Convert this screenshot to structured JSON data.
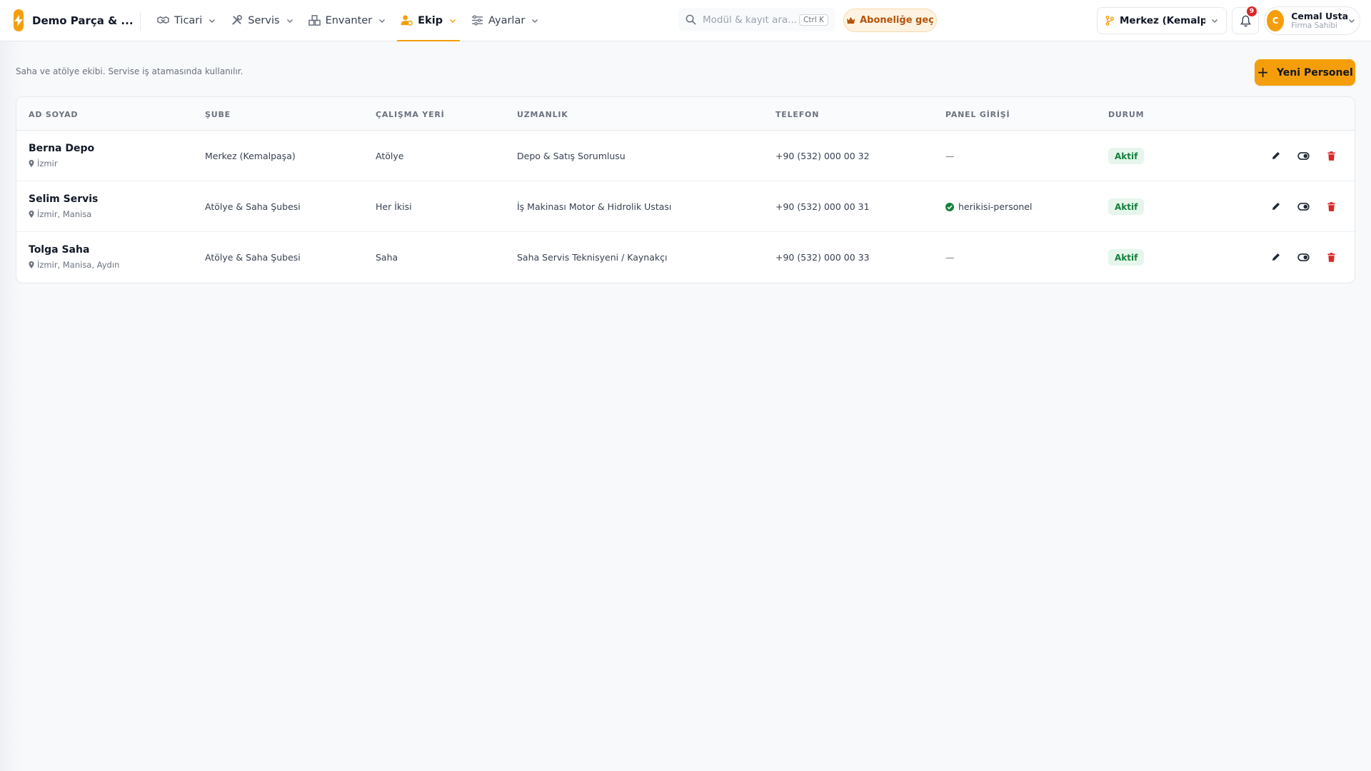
{
  "brand": {
    "name": "Demo Parça & ..."
  },
  "nav": [
    {
      "label": "Ticari",
      "icon": "handshake-icon"
    },
    {
      "label": "Servis",
      "icon": "tools-icon"
    },
    {
      "label": "Envanter",
      "icon": "boxes-icon"
    },
    {
      "label": "Ekip",
      "icon": "user-gear-icon",
      "active": true
    },
    {
      "label": "Ayarlar",
      "icon": "sliders-icon"
    }
  ],
  "search": {
    "placeholder": "Modül & kayıt ara...",
    "shortcut": "Ctrl K"
  },
  "upgrade": {
    "label": "Aboneliğe geç"
  },
  "branch": {
    "label": "Merkez (Kemalpa..."
  },
  "notifications": {
    "count": "9"
  },
  "user": {
    "initial": "C",
    "name": "Cemal Usta",
    "role": "Firma Sahibi"
  },
  "page": {
    "subtitle": "Saha ve atölye ekibi. Servise iş atamasında kullanılır.",
    "new_button": "Yeni Personel"
  },
  "table": {
    "headers": {
      "name": "AD SOYAD",
      "branch": "ŞUBE",
      "workplace": "ÇALIŞMA YERİ",
      "specialty": "UZMANLIK",
      "phone": "TELEFON",
      "panel": "PANEL GİRİŞİ",
      "status": "DURUM"
    },
    "rows": [
      {
        "name": "Berna Depo",
        "location": "İzmir",
        "branch": "Merkez (Kemalpaşa)",
        "workplace": "Atölye",
        "specialty": "Depo & Satış Sorumlusu",
        "phone": "+90 (532) 000 00 32",
        "panel": "—",
        "status": "Aktif"
      },
      {
        "name": "Selim Servis",
        "location": "İzmir, Manisa",
        "branch": "Atölye & Saha Şubesi",
        "workplace": "Her İkisi",
        "specialty": "İş Makinası Motor & Hidrolik Ustası",
        "phone": "+90 (532) 000 00 31",
        "panel": "herikisi-personel",
        "status": "Aktif"
      },
      {
        "name": "Tolga Saha",
        "location": "İzmir, Manisa, Aydın",
        "branch": "Atölye & Saha Şubesi",
        "workplace": "Saha",
        "specialty": "Saha Servis Teknisyeni / Kaynakçı",
        "phone": "+90 (532) 000 00 33",
        "panel": "—",
        "status": "Aktif"
      }
    ]
  },
  "colors": {
    "accent": "#f59e0b",
    "success": "#15803d",
    "danger": "#dc2626"
  }
}
